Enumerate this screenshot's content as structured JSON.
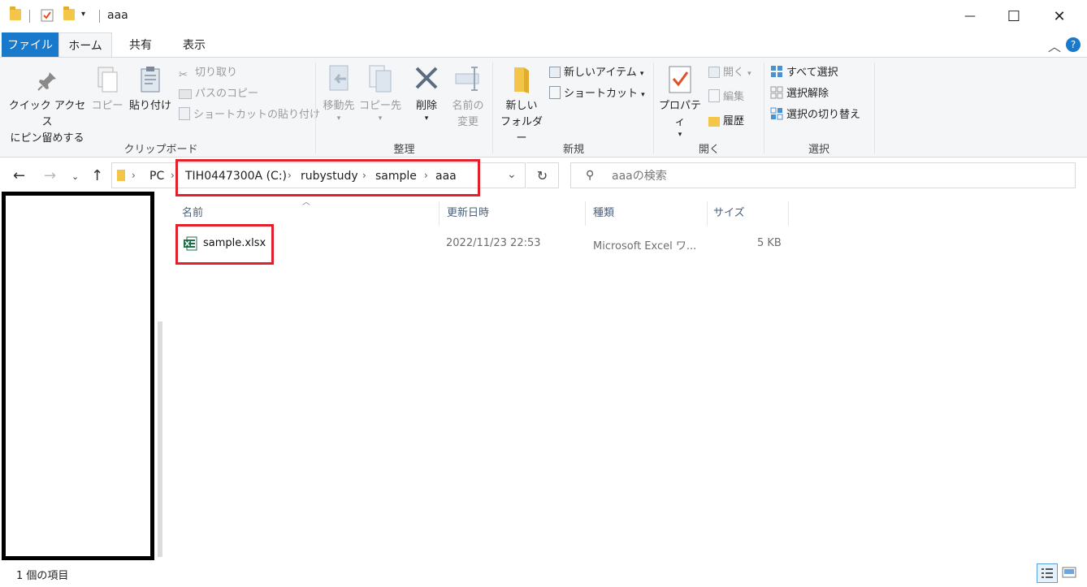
{
  "window": {
    "title": "aaa",
    "minimize": "—",
    "maximize": "☐",
    "close": "✕"
  },
  "tabs": {
    "file": "ファイル",
    "home": "ホーム",
    "share": "共有",
    "view": "表示"
  },
  "ribbon": {
    "clipboard": {
      "label": "クリップボード",
      "pin_line1": "クイック アクセス",
      "pin_line2": "にピン留めする",
      "copy": "コピー",
      "paste": "貼り付け",
      "cut": "切り取り",
      "copy_path": "パスのコピー",
      "paste_shortcut": "ショートカットの貼り付け"
    },
    "organize": {
      "label": "整理",
      "move_to": "移動先",
      "copy_to": "コピー先",
      "delete": "削除",
      "rename_line1": "名前の",
      "rename_line2": "変更"
    },
    "new": {
      "label": "新規",
      "new_folder_line1": "新しい",
      "new_folder_line2": "フォルダー",
      "new_item": "新しいアイテム",
      "shortcut": "ショートカット"
    },
    "open": {
      "label": "開く",
      "properties": "プロパティ",
      "open": "開く",
      "edit": "編集",
      "history": "履歴"
    },
    "select": {
      "label": "選択",
      "select_all": "すべて選択",
      "select_none": "選択解除",
      "invert": "選択の切り替え"
    }
  },
  "address": {
    "crumbs": [
      "PC",
      "TIH0447300A (C:)",
      "rubystudy",
      "sample",
      "aaa"
    ],
    "search_placeholder": "aaaの検索"
  },
  "columns": {
    "name": "名前",
    "modified": "更新日時",
    "type": "種類",
    "size": "サイズ"
  },
  "files": [
    {
      "name": "sample.xlsx",
      "modified": "2022/11/23 22:53",
      "type": "Microsoft Excel ワ...",
      "size": "5 KB"
    }
  ],
  "status": {
    "count": "1 個の項目"
  },
  "colors": {
    "accent": "#1979ca",
    "highlight_box": "#e0202a",
    "excel_green": "#1d7044"
  }
}
